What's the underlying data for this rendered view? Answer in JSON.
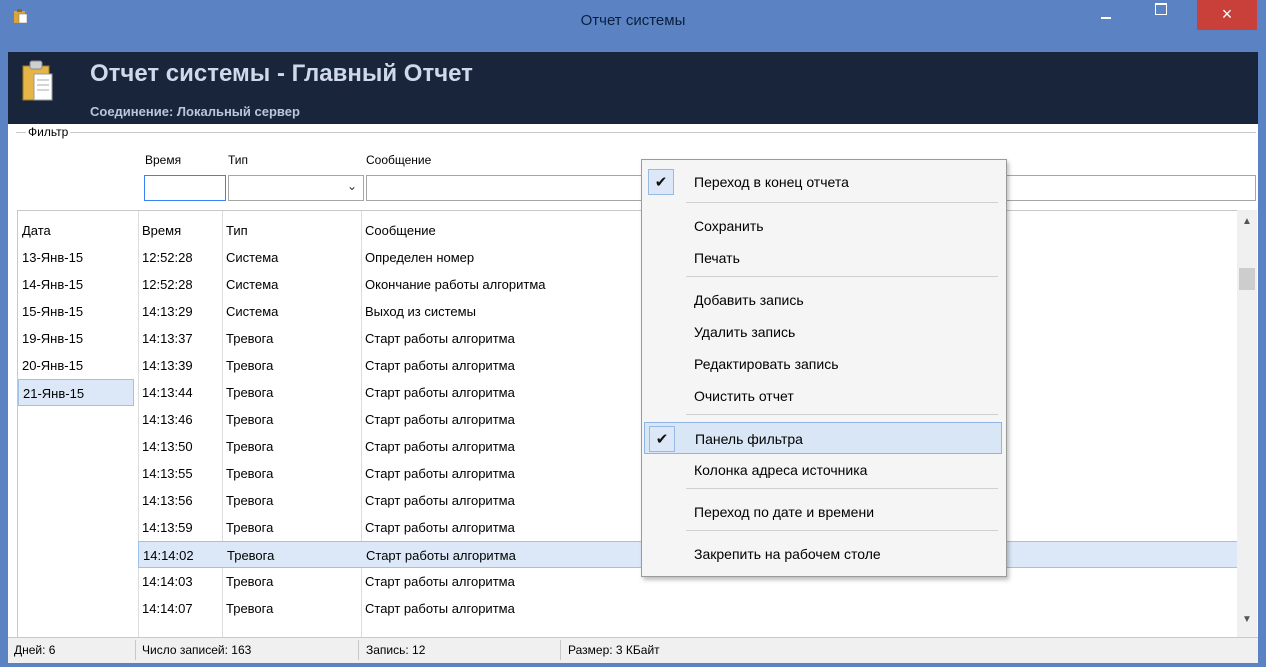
{
  "window": {
    "title": "Отчет системы",
    "close_glyph": "×"
  },
  "header": {
    "title": "Отчет системы - Главный Отчет",
    "subtitle": "Соединение: Локальный сервер"
  },
  "filter": {
    "legend": "Фильтр",
    "time_label": "Время",
    "type_label": "Тип",
    "message_label": "Сообщение",
    "time_value": "",
    "type_value": "",
    "message_value": ""
  },
  "dates": {
    "header": "Дата",
    "items": [
      "13-Янв-15",
      "14-Янв-15",
      "15-Янв-15",
      "19-Янв-15",
      "20-Янв-15",
      "21-Янв-15"
    ],
    "selected_index": 5
  },
  "table": {
    "columns": [
      "Время",
      "Тип",
      "Сообщение"
    ],
    "rows": [
      [
        "12:52:28",
        "Система",
        "Определен номер"
      ],
      [
        "12:52:28",
        "Система",
        "Окончание работы алгоритма"
      ],
      [
        "14:13:29",
        "Система",
        "Выход из системы"
      ],
      [
        "14:13:37",
        "Тревога",
        "Старт работы алгоритма"
      ],
      [
        "14:13:39",
        "Тревога",
        "Старт работы алгоритма"
      ],
      [
        "14:13:44",
        "Тревога",
        "Старт работы алгоритма"
      ],
      [
        "14:13:46",
        "Тревога",
        "Старт работы алгоритма"
      ],
      [
        "14:13:50",
        "Тревога",
        "Старт работы алгоритма"
      ],
      [
        "14:13:55",
        "Тревога",
        "Старт работы алгоритма"
      ],
      [
        "14:13:56",
        "Тревога",
        "Старт работы алгоритма"
      ],
      [
        "14:13:59",
        "Тревога",
        "Старт работы алгоритма"
      ],
      [
        "14:14:02",
        "Тревога",
        "Старт работы алгоритма"
      ],
      [
        "14:14:03",
        "Тревога",
        "Старт работы алгоритма"
      ],
      [
        "14:14:07",
        "Тревога",
        "Старт работы алгоритма"
      ]
    ],
    "selected_index": 11
  },
  "status": {
    "days": "Дней: 6",
    "records": "Число записей: 163",
    "record": "Запись: 12",
    "size": "Размер: 3 КБайт"
  },
  "context_menu": {
    "items": [
      {
        "label": "Переход в конец отчета",
        "checked": true
      },
      {
        "label": "Сохранить"
      },
      {
        "label": "Печать"
      },
      {
        "label": "Добавить запись"
      },
      {
        "label": "Удалить запись"
      },
      {
        "label": "Редактировать запись"
      },
      {
        "label": "Очистить отчет"
      },
      {
        "label": "Панель фильтра",
        "checked": true,
        "highlighted": true
      },
      {
        "label": "Колонка адреса источника"
      },
      {
        "label": "Переход по дате и времени"
      },
      {
        "label": "Закрепить на рабочем столе"
      }
    ],
    "check_glyph": "✔"
  },
  "colors": {
    "title_bar": "#5b83c4",
    "header_bg": "#18253b",
    "close_button": "#c9403a",
    "selection": "#dce8f7"
  }
}
